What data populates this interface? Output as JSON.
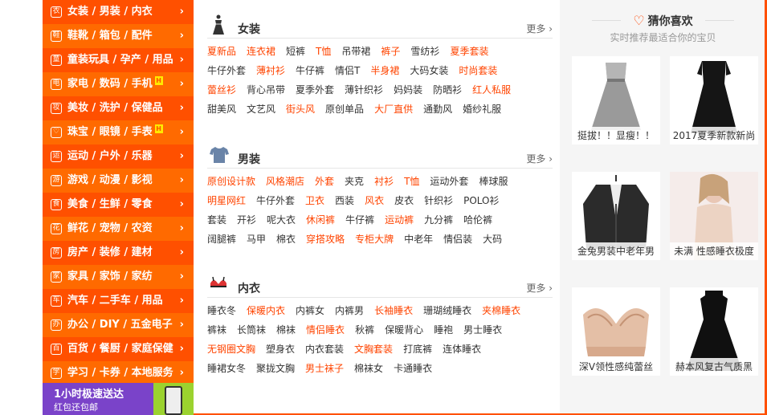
{
  "sidebar": {
    "categories": [
      {
        "icon": "shirt-icon",
        "glyph": "衣",
        "label": "女装 / 男装 / 内衣",
        "hot": ""
      },
      {
        "icon": "shoe-icon",
        "glyph": "鞋",
        "label": "鞋靴 / 箱包 / 配件",
        "hot": ""
      },
      {
        "icon": "bottle-icon",
        "glyph": "童",
        "label": "童装玩具 / 孕产 / 用品",
        "hot": ""
      },
      {
        "icon": "appliance-icon",
        "glyph": "电",
        "label": "家电 / 数码 / 手机",
        "hot": "H"
      },
      {
        "icon": "lipstick-icon",
        "glyph": "妆",
        "label": "美妆 / 洗护 / 保健品",
        "hot": ""
      },
      {
        "icon": "heart-icon",
        "glyph": "♡",
        "label": "珠宝 / 眼镜 / 手表",
        "hot": "H"
      },
      {
        "icon": "ball-icon",
        "glyph": "运",
        "label": "运动 / 户外 / 乐器",
        "hot": ""
      },
      {
        "icon": "game-icon",
        "glyph": "游",
        "label": "游戏 / 动漫 / 影视",
        "hot": ""
      },
      {
        "icon": "cup-icon",
        "glyph": "食",
        "label": "美食 / 生鲜 / 零食",
        "hot": ""
      },
      {
        "icon": "plant-icon",
        "glyph": "花",
        "label": "鲜花 / 宠物 / 农资",
        "hot": ""
      },
      {
        "icon": "house-icon",
        "glyph": "房",
        "label": "房产 / 装修 / 建材",
        "hot": ""
      },
      {
        "icon": "sofa-icon",
        "glyph": "家",
        "label": "家具 / 家饰 / 家纺",
        "hot": ""
      },
      {
        "icon": "car-icon",
        "glyph": "车",
        "label": "汽车 / 二手车 / 用品",
        "hot": ""
      },
      {
        "icon": "monitor-icon",
        "glyph": "办",
        "label": "办公 / DIY / 五金电子",
        "hot": ""
      },
      {
        "icon": "bag-icon",
        "glyph": "百",
        "label": "百货 / 餐厨 / 家庭保健",
        "hot": ""
      },
      {
        "icon": "ticket-icon",
        "glyph": "学",
        "label": "学习 / 卡券 / 本地服务",
        "hot": ""
      }
    ],
    "arrow": "›",
    "promo_title": "1小时极速送达",
    "promo_sub": "红包还包邮"
  },
  "sections": [
    {
      "icon": "dress-icon",
      "title": "女装",
      "more": "更多 ›",
      "rows": [
        [
          {
            "t": "夏新品",
            "hl": true
          },
          {
            "t": "连衣裙",
            "hl": true
          },
          {
            "t": "短裤",
            "hl": false
          },
          {
            "t": "T恤",
            "hl": true
          },
          {
            "t": "吊带裙",
            "hl": false
          },
          {
            "t": "裤子",
            "hl": true
          },
          {
            "t": "雪纺衫",
            "hl": false
          },
          {
            "t": "夏季套装",
            "hl": true
          }
        ],
        [
          {
            "t": "牛仔外套",
            "hl": false
          },
          {
            "t": "薄衬衫",
            "hl": true
          },
          {
            "t": "牛仔裤",
            "hl": false
          },
          {
            "t": "情侣T",
            "hl": false
          },
          {
            "t": "半身裙",
            "hl": true
          },
          {
            "t": "大码女装",
            "hl": false
          },
          {
            "t": "时尚套装",
            "hl": true
          }
        ],
        [
          {
            "t": "蕾丝衫",
            "hl": true
          },
          {
            "t": "背心吊带",
            "hl": false
          },
          {
            "t": "夏季外套",
            "hl": false
          },
          {
            "t": "薄针织衫",
            "hl": false
          },
          {
            "t": "妈妈装",
            "hl": false
          },
          {
            "t": "防晒衫",
            "hl": false
          },
          {
            "t": "红人私服",
            "hl": true
          }
        ],
        [
          {
            "t": "甜美风",
            "hl": false
          },
          {
            "t": "文艺风",
            "hl": false
          },
          {
            "t": "街头风",
            "hl": true
          },
          {
            "t": "原创单品",
            "hl": false
          },
          {
            "t": "大厂直供",
            "hl": true
          },
          {
            "t": "通勤风",
            "hl": false
          },
          {
            "t": "婚纱礼服",
            "hl": false
          }
        ]
      ]
    },
    {
      "icon": "tshirt-icon",
      "title": "男装",
      "more": "更多 ›",
      "rows": [
        [
          {
            "t": "原创设计款",
            "hl": true
          },
          {
            "t": "风格潮店",
            "hl": true
          },
          {
            "t": "外套",
            "hl": true
          },
          {
            "t": "夹克",
            "hl": false
          },
          {
            "t": "衬衫",
            "hl": true
          },
          {
            "t": "T恤",
            "hl": true
          },
          {
            "t": "运动外套",
            "hl": false
          },
          {
            "t": "棒球服",
            "hl": false
          }
        ],
        [
          {
            "t": "明星网红",
            "hl": true
          },
          {
            "t": "牛仔外套",
            "hl": false
          },
          {
            "t": "卫衣",
            "hl": true
          },
          {
            "t": "西装",
            "hl": false
          },
          {
            "t": "风衣",
            "hl": true
          },
          {
            "t": "皮衣",
            "hl": false
          },
          {
            "t": "针织衫",
            "hl": false
          },
          {
            "t": "POLO衫",
            "hl": false
          }
        ],
        [
          {
            "t": "套装",
            "hl": false
          },
          {
            "t": "开衫",
            "hl": false
          },
          {
            "t": "呢大衣",
            "hl": false
          },
          {
            "t": "休闲裤",
            "hl": true
          },
          {
            "t": "牛仔裤",
            "hl": false
          },
          {
            "t": "运动裤",
            "hl": true
          },
          {
            "t": "九分裤",
            "hl": false
          },
          {
            "t": "哈伦裤",
            "hl": false
          }
        ],
        [
          {
            "t": "阔腿裤",
            "hl": false
          },
          {
            "t": "马甲",
            "hl": false
          },
          {
            "t": "棉衣",
            "hl": false
          },
          {
            "t": "穿搭攻略",
            "hl": true
          },
          {
            "t": "专柜大牌",
            "hl": true
          },
          {
            "t": "中老年",
            "hl": false
          },
          {
            "t": "情侣装",
            "hl": false
          },
          {
            "t": "大码",
            "hl": false
          }
        ]
      ]
    },
    {
      "icon": "bra-icon",
      "title": "内衣",
      "more": "更多 ›",
      "rows": [
        [
          {
            "t": "睡衣冬",
            "hl": false
          },
          {
            "t": "保暖内衣",
            "hl": true
          },
          {
            "t": "内裤女",
            "hl": false
          },
          {
            "t": "内裤男",
            "hl": false
          },
          {
            "t": "长袖睡衣",
            "hl": true
          },
          {
            "t": "珊瑚绒睡衣",
            "hl": false
          },
          {
            "t": "夹棉睡衣",
            "hl": true
          }
        ],
        [
          {
            "t": "裤袜",
            "hl": false
          },
          {
            "t": "长筒袜",
            "hl": false
          },
          {
            "t": "棉袜",
            "hl": false
          },
          {
            "t": "情侣睡衣",
            "hl": true
          },
          {
            "t": "秋裤",
            "hl": false
          },
          {
            "t": "保暖背心",
            "hl": false
          },
          {
            "t": "睡袍",
            "hl": false
          },
          {
            "t": "男士睡衣",
            "hl": false
          }
        ],
        [
          {
            "t": "无钢圈文胸",
            "hl": true
          },
          {
            "t": "塑身衣",
            "hl": false
          },
          {
            "t": "内衣套装",
            "hl": false
          },
          {
            "t": "文胸套装",
            "hl": true
          },
          {
            "t": "打底裤",
            "hl": false
          },
          {
            "t": "连体睡衣",
            "hl": false
          }
        ],
        [
          {
            "t": "睡裙女冬",
            "hl": false
          },
          {
            "t": "聚拢文胸",
            "hl": false
          },
          {
            "t": "男士袜子",
            "hl": true
          },
          {
            "t": "棉袜女",
            "hl": false
          },
          {
            "t": "卡通睡衣",
            "hl": false
          }
        ]
      ]
    }
  ],
  "recommend": {
    "title": "猜你喜欢",
    "subtitle": "实时推荐最适合你的宝贝",
    "products": [
      {
        "caption": "挺拔！！显瘦！！",
        "icon": "grey-dress-icon"
      },
      {
        "caption": "2017夏季新款新尚",
        "icon": "black-dress-icon"
      },
      {
        "caption": "金兔男装中老年男",
        "icon": "cardigan-icon"
      },
      {
        "caption": "未满 性感睡衣极度",
        "icon": "nightwear-icon"
      },
      {
        "caption": "深V领性感纯蕾丝",
        "icon": "lace-bra-icon"
      },
      {
        "caption": "赫本风复古气质黑",
        "icon": "vintage-dress-icon"
      }
    ]
  },
  "colors": {
    "accent": "#ff5000",
    "highlight": "#f40"
  }
}
